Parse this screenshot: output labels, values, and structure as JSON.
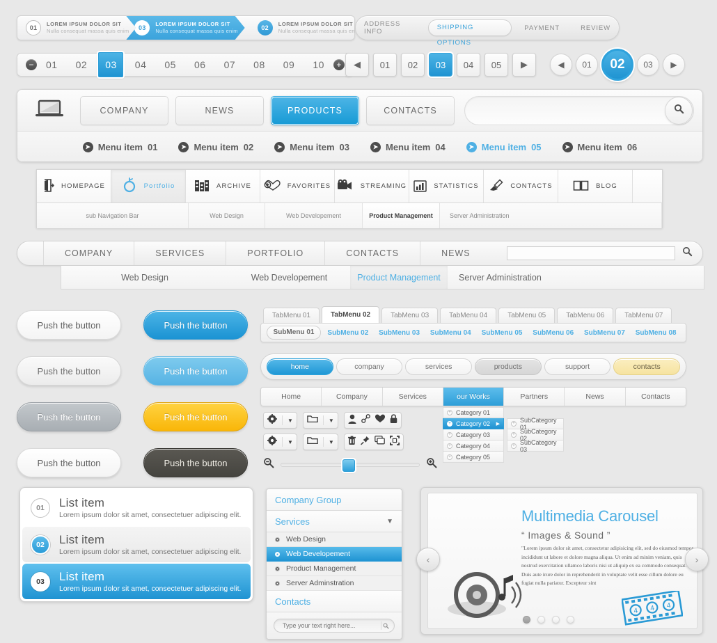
{
  "steps": {
    "items": [
      {
        "num": "01",
        "title": "LOREM IPSUM DOLOR SIT",
        "sub": "Nulla consequat massa quis enim",
        "state": "plain"
      },
      {
        "num": "03",
        "title": "LOREM IPSUM DOLOR SIT",
        "sub": "Nulla consequat massa quis enim",
        "state": "active"
      },
      {
        "num": "02",
        "title": "LOREM IPSUM DOLOR SIT",
        "sub": "Nulla consequat massa quis enim",
        "state": "blue"
      }
    ]
  },
  "checkout": {
    "items": [
      "ADDRESS INFO",
      "SHIPPING OPTIONS",
      "PAYMENT",
      "REVIEW"
    ],
    "active": "SHIPPING OPTIONS"
  },
  "pager1": {
    "minus": "−",
    "plus": "+",
    "pages": [
      "01",
      "02",
      "03",
      "04",
      "05",
      "06",
      "07",
      "08",
      "09",
      "10"
    ],
    "selected": "03"
  },
  "pager2": {
    "prev": "◀",
    "next": "▶",
    "pages": [
      "01",
      "02",
      "03",
      "04",
      "05"
    ],
    "selected": "03"
  },
  "pager3": {
    "prev": "◀",
    "next": "▶",
    "pages": [
      "01",
      "02",
      "03"
    ],
    "selected": "02"
  },
  "mainnav": {
    "logo_icon": "laptop-icon",
    "buttons": [
      "COMPANY",
      "NEWS",
      "PRODUCTS",
      "CONTACTS"
    ],
    "active": "PRODUCTS",
    "search_placeholder": "",
    "search_value": "",
    "search_icon": "search-icon",
    "menu_items": [
      {
        "label": "Menu item",
        "num": "01",
        "active": false
      },
      {
        "label": "Menu item",
        "num": "02",
        "active": false
      },
      {
        "label": "Menu item",
        "num": "03",
        "active": false
      },
      {
        "label": "Menu item",
        "num": "04",
        "active": false
      },
      {
        "label": "Menu item",
        "num": "05",
        "active": true
      },
      {
        "label": "Menu item",
        "num": "06",
        "active": false
      }
    ]
  },
  "iconnav": {
    "items": [
      {
        "label": "HOMEPAGE",
        "icon": "door-exit-icon",
        "selected": false
      },
      {
        "label": "Portfolio",
        "icon": "target-circle-icon",
        "selected": true
      },
      {
        "label": "ARCHIVE",
        "icon": "archive-boxes-icon",
        "selected": false
      },
      {
        "label": "FAVORITES",
        "icon": "hearts-icon",
        "selected": false
      },
      {
        "label": "STREAMING",
        "icon": "video-camera-icon",
        "selected": false
      },
      {
        "label": "STATISTICS",
        "icon": "bar-chart-icon",
        "selected": false
      },
      {
        "label": "CONTACTS",
        "icon": "pen-write-icon",
        "selected": false
      },
      {
        "label": "BLOG",
        "icon": "open-book-icon",
        "selected": false
      }
    ],
    "subitems": [
      {
        "label": "sub Navigation Bar",
        "active": false
      },
      {
        "label": "Web Design",
        "active": false
      },
      {
        "label": "Web Developement",
        "active": false
      },
      {
        "label": "Product Management",
        "active": true
      },
      {
        "label": "Server Administration",
        "active": false
      }
    ]
  },
  "nav3": {
    "items": [
      "COMPANY",
      "SERVICES",
      "PORTFOLIO",
      "CONTACTS",
      "NEWS"
    ],
    "active": "SERVICES",
    "search_value": "",
    "search_icon": "search-icon",
    "subitems": [
      "Web Design",
      "Web Developement",
      "Product Management",
      "Server Administration"
    ],
    "sub_active": "Product Management"
  },
  "buttons": {
    "label": "Push the button",
    "styles": [
      "white",
      "blue",
      "white2",
      "blue2",
      "grey",
      "yellow",
      "white",
      "dark"
    ]
  },
  "tabs": {
    "tabmenus": [
      "TabMenu 01",
      "TabMenu 02",
      "TabMenu 03",
      "TabMenu 04",
      "TabMenu 05",
      "TabMenu 06",
      "TabMenu 07"
    ],
    "tab_active": "TabMenu 02",
    "submenus": [
      "SubMenu 01",
      "SubMenu 02",
      "SubMenu 03",
      "SubMenu 04",
      "SubMenu 05",
      "SubMenu 06",
      "SubMenu 07",
      "SubMenu 08"
    ],
    "sub_active": "SubMenu 01"
  },
  "pillnav": {
    "items": [
      {
        "label": "home",
        "style": "on"
      },
      {
        "label": "company",
        "style": ""
      },
      {
        "label": "services",
        "style": ""
      },
      {
        "label": "products",
        "style": "grey"
      },
      {
        "label": "support",
        "style": ""
      },
      {
        "label": "contacts",
        "style": "yellow"
      }
    ]
  },
  "segbar": {
    "items": [
      "Home",
      "Company",
      "Services",
      "our Works",
      "Partners",
      "News",
      "Contacts"
    ],
    "active": "our Works"
  },
  "toolbar": {
    "row1": [
      "gear-icon",
      "chevron-down-icon",
      "folder-icon",
      "chevron-down-icon",
      "user-icon",
      "link-icon",
      "heart-icon",
      "lock-icon"
    ],
    "row2": [
      "gear-icon",
      "chevron-down-icon",
      "folder-icon",
      "chevron-down-icon",
      "trash-icon",
      "pin-icon",
      "copy-icon",
      "crop-icon"
    ],
    "zoom_out_icon": "zoom-out-icon",
    "zoom_in_icon": "zoom-in-icon",
    "zoom_value": 42
  },
  "categories": {
    "items": [
      {
        "label": "Category 01",
        "active": false
      },
      {
        "label": "Category 02",
        "active": true
      },
      {
        "label": "Category 03",
        "active": false
      },
      {
        "label": "Category 04",
        "active": false
      },
      {
        "label": "Category 05",
        "active": false
      }
    ],
    "subitems": [
      "SubCategory 01",
      "SubCategory 02",
      "SubCategory 03"
    ]
  },
  "list": {
    "items": [
      {
        "num": "01",
        "title": "List item",
        "text": "Lorem ipsum dolor sit amet, consectetuer adipiscing elit."
      },
      {
        "num": "02",
        "title": "List item",
        "text": "Lorem ipsum dolor sit amet, consectetuer adipiscing elit."
      },
      {
        "num": "03",
        "title": "List item",
        "text": "Lorem ipsum dolor sit amet, consectetuer adipiscing elit."
      }
    ]
  },
  "accordion": {
    "head1": "Company Group",
    "head2": "Services",
    "head3": "Contacts",
    "caret_icon": "caret-down-icon",
    "items": [
      {
        "label": "Web Design",
        "active": false
      },
      {
        "label": "Web Developement",
        "active": true
      },
      {
        "label": "Product Management",
        "active": false
      },
      {
        "label": "Server Adminstration",
        "active": false
      }
    ],
    "search_placeholder": "Type your text right here...",
    "search_value": "",
    "search_icon": "search-icon"
  },
  "carousel": {
    "title": "Multimedia Carousel",
    "subtitle": "“ Images & Sound ”",
    "paragraph": "\"Lorem ipsum dolor sit amet, consectetur adipisicing elit, sed do eiusmod tempor incididunt ut labore et dolore magna aliqua. Ut enim ad minim veniam, quis nostrud exercitation ullamco laboris nisi ut aliquip ex ea commodo consequat. Duis aute irure dolor in reprehenderit in voluptate velit esse cillum dolore eu fugiat nulla pariatur. Excepteur sint",
    "prev_icon": "chevron-left-icon",
    "next_icon": "chevron-right-icon",
    "dots": 4,
    "active_dot": 0,
    "media_icon": "speaker-music-icon",
    "film_icon": "film-strip-icon"
  },
  "colors": {
    "accent": "#2f9fd8",
    "yellow": "#f9b609",
    "dark": "#45443f"
  }
}
